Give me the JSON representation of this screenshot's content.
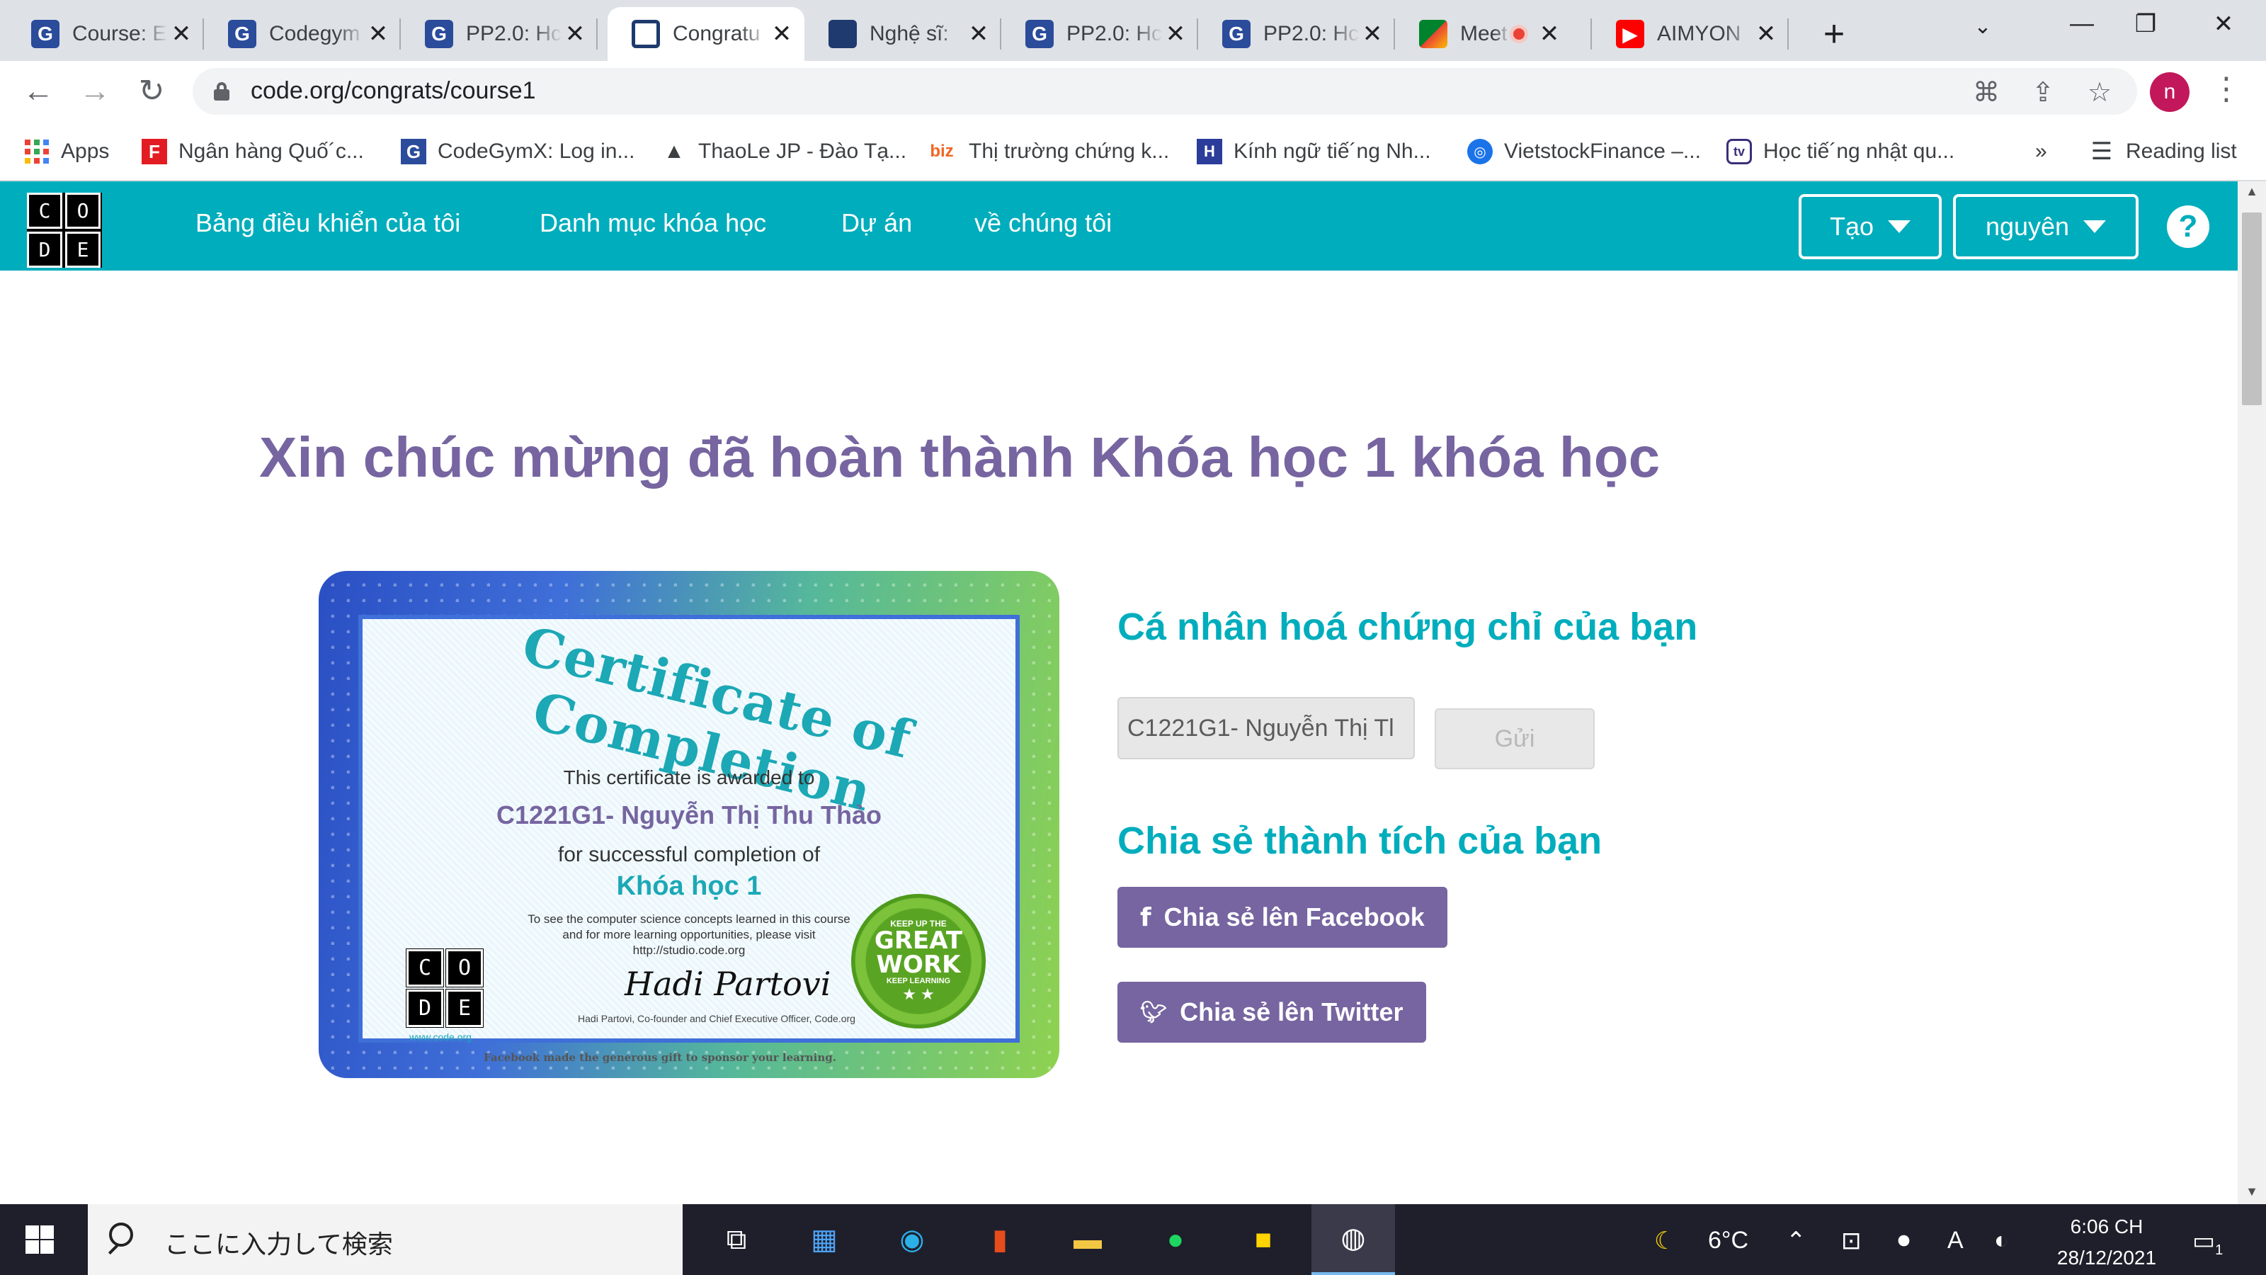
{
  "browser": {
    "tabs": [
      {
        "title": "Course: E",
        "icon": "codegym-favicon"
      },
      {
        "title": "Codegym",
        "icon": "codegym-favicon"
      },
      {
        "title": "PP2.0: Hc",
        "icon": "codegym-favicon"
      },
      {
        "title": "Congratu",
        "icon": "code-org-favicon",
        "active": true
      },
      {
        "title": "Nghệ sĩ:",
        "icon": "code-org-favicon"
      },
      {
        "title": "PP2.0: Hc",
        "icon": "codegym-favicon"
      },
      {
        "title": "PP2.0: Hc",
        "icon": "codegym-favicon"
      },
      {
        "title": "Meet",
        "icon": "google-meet-favicon",
        "recording": true
      },
      {
        "title": "AIMYON",
        "icon": "youtube-favicon"
      }
    ],
    "url": "code.org/congrats/course1",
    "avatar_letter": "n",
    "bookmarks": [
      {
        "label": "Apps"
      },
      {
        "label": "Ngân hàng Quố´c..."
      },
      {
        "label": "CodeGymX: Log in..."
      },
      {
        "label": "ThaoLe JP - Đào Tạ..."
      },
      {
        "label": "Thị trường chứng k...",
        "icon_text": "biz"
      },
      {
        "label": "Kính ngữ tiế´ng Nh..."
      },
      {
        "label": "VietstockFinance –..."
      },
      {
        "label": "Học tiế´ng nhật qu..."
      }
    ],
    "bookmarks_overflow": "»",
    "reading_list": "Reading list"
  },
  "site": {
    "logo_letters": [
      "C",
      "O",
      "D",
      "E"
    ],
    "nav": [
      "Bảng điều khiển của tôi",
      "Danh mục khóa học",
      "Dự án",
      "về chúng tôi"
    ],
    "create_label": "Tạo",
    "user_label": "nguyên",
    "help_label": "?"
  },
  "main": {
    "heading": "Xin chúc mừng đã hoàn thành Khóa học 1 khóa học",
    "certificate": {
      "title": "Certificate of Completion",
      "awarded_to": "This certificate is awarded to",
      "recipient": "C1221G1- Nguyễn Thị Thu Thảo",
      "for_completion": "for successful completion of",
      "course": "Khóa học 1",
      "note_line1": "To see the computer science concepts learned in this course",
      "note_line2": "and for more learning opportunities, please visit",
      "note_line3": "http://studio.code.org",
      "signature": "Hadi Partovi",
      "signer": "Hadi Partovi, Co-founder and Chief Executive Officer, Code.org",
      "site": "www.code.org",
      "sponsor": "Facebook made the generous gift to sponsor your learning.",
      "seal_top": "KEEP UP THE",
      "seal_main1": "GREAT",
      "seal_main2": "WORK",
      "seal_bottom": "KEEP LEARNING"
    },
    "personalize_heading": "Cá nhân hoá chứng chỉ của bạn",
    "name_value": "C1221G1- Nguyễn Thị Tl",
    "send_label": "Gửi",
    "share_heading": "Chia sẻ thành tích của bạn",
    "facebook_label": "Chia sẻ lên Facebook",
    "twitter_label": "Chia sẻ lên Twitter"
  },
  "taskbar": {
    "search_placeholder": "ここに入力して検索",
    "temperature": "6°C",
    "ime": "A",
    "time": "6:06 CH",
    "date": "28/12/2021",
    "notifications": "1"
  },
  "colors": {
    "brand_teal": "#00adbc",
    "purple": "#7665a0"
  }
}
